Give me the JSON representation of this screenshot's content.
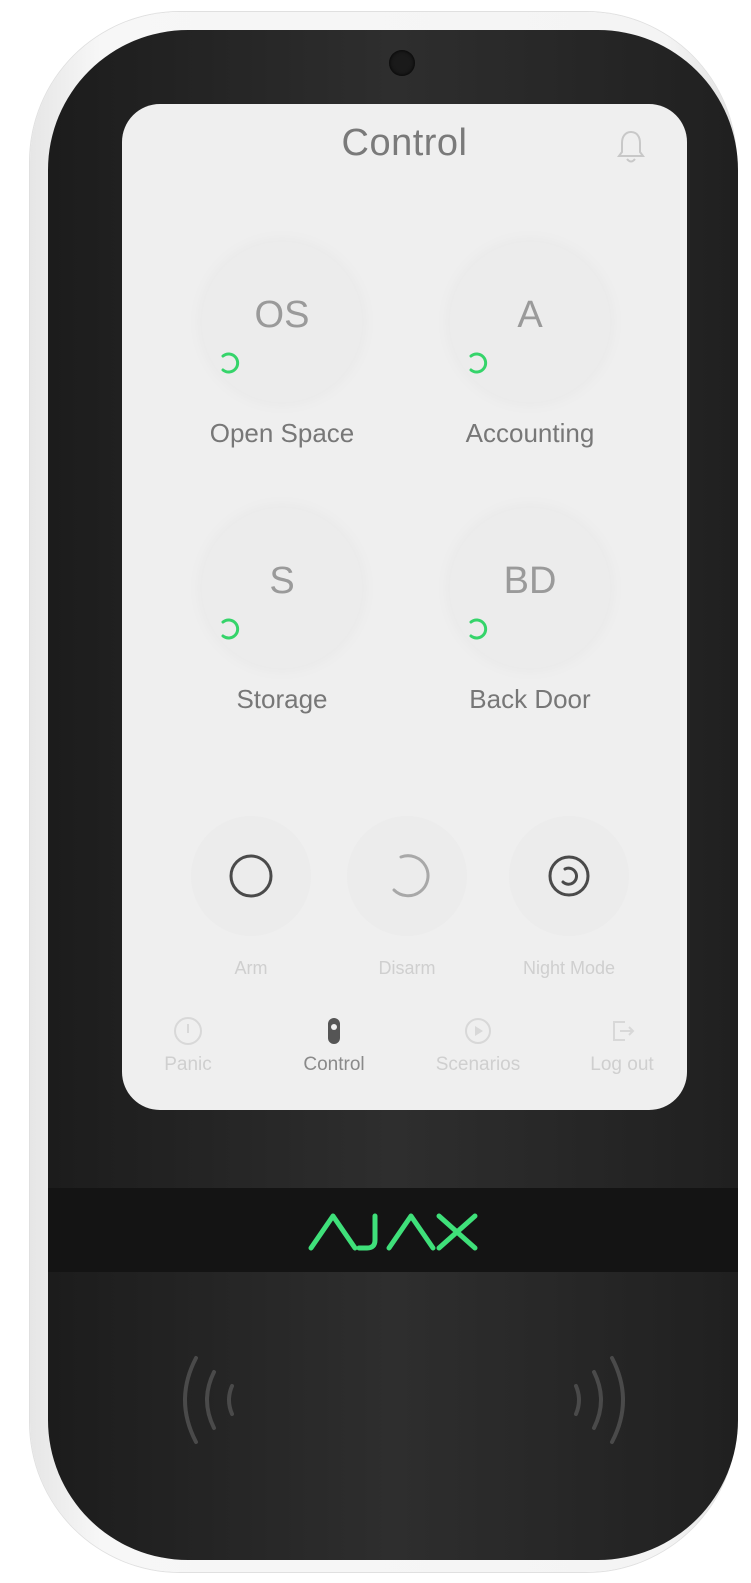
{
  "screen": {
    "title": "Control"
  },
  "groups": [
    {
      "abbr": "OS",
      "name": "Open Space"
    },
    {
      "abbr": "A",
      "name": "Accounting"
    },
    {
      "abbr": "S",
      "name": "Storage"
    },
    {
      "abbr": "BD",
      "name": "Back Door"
    }
  ],
  "modes": [
    {
      "label": "Arm",
      "icon": "arm-circle-icon"
    },
    {
      "label": "Disarm",
      "icon": "disarm-partial-circle-icon"
    },
    {
      "label": "Night Mode",
      "icon": "night-mode-icon"
    }
  ],
  "nav": [
    {
      "label": "Panic",
      "icon": "panic-icon",
      "active": false
    },
    {
      "label": "Control",
      "icon": "shield-icon",
      "active": true
    },
    {
      "label": "Scenarios",
      "icon": "scenario-icon",
      "active": false
    },
    {
      "label": "Log out",
      "icon": "logout-icon",
      "active": false
    }
  ],
  "brand": {
    "logo_text": "AJAX",
    "logo_color": "#3fe07a"
  },
  "colors": {
    "status_green": "#35d46a",
    "device_body": "#262626",
    "screen_bg": "#efefef"
  }
}
